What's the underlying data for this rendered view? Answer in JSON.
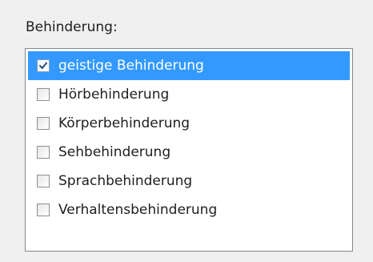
{
  "section": {
    "label": "Behinderung:"
  },
  "list": {
    "items": [
      {
        "label": "geistige Behinderung",
        "checked": true,
        "selected": true
      },
      {
        "label": "Hörbehinderung",
        "checked": false,
        "selected": false
      },
      {
        "label": "Körperbehinderung",
        "checked": false,
        "selected": false
      },
      {
        "label": "Sehbehinderung",
        "checked": false,
        "selected": false
      },
      {
        "label": "Sprachbehinderung",
        "checked": false,
        "selected": false
      },
      {
        "label": "Verhaltensbehinderung",
        "checked": false,
        "selected": false
      }
    ]
  },
  "colors": {
    "selection": "#3399ff",
    "panel_background": "#f0f0f0",
    "list_border": "#828790"
  }
}
